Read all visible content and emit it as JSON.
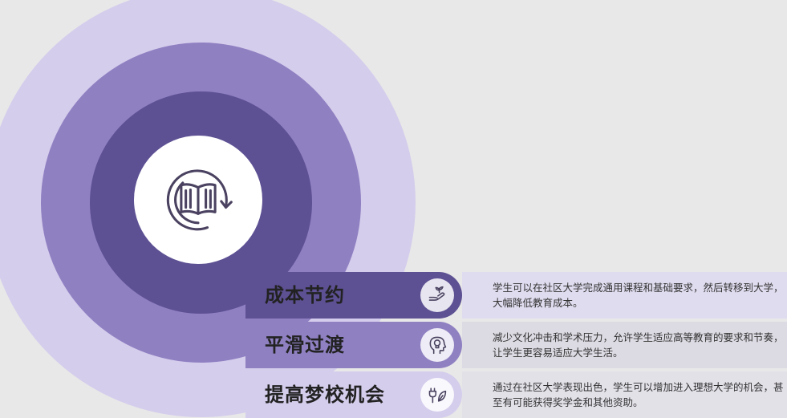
{
  "diagram": {
    "center_icon": "book-cycle-icon",
    "colors": {
      "background": "#e8e8e8",
      "outer_ring": "#d5cdec",
      "middle_ring": "#8f80c2",
      "inner_ring": "#5d5093",
      "center": "#ffffff"
    },
    "items": [
      {
        "title": "成本节约",
        "icon": "hand-plant-icon",
        "description": "学生可以在社区大学完成通用课程和基础要求，然后转移到大学，大幅降低教育成本。",
        "color": "#5d5093"
      },
      {
        "title": "平滑过渡",
        "icon": "head-lightbulb-icon",
        "description": "减少文化冲击和学术压力，允许学生适应高等教育的要求和节奏，让学生更容易适应大学生活。",
        "color": "#8f80c2"
      },
      {
        "title": "提高梦校机会",
        "icon": "plug-leaf-icon",
        "description": "通过在社区大学表现出色，学生可以增加进入理想大学的机会，甚至有可能获得奖学金和其他资助。",
        "color": "#d5cdec"
      }
    ]
  }
}
